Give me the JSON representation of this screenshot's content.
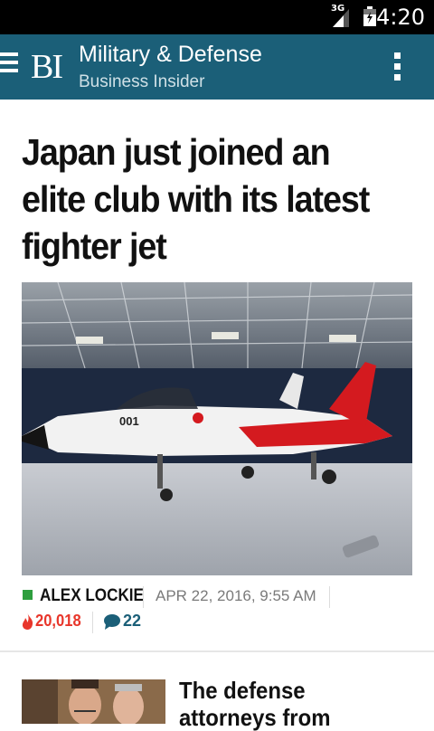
{
  "status_bar": {
    "network": "3G",
    "time": "4:20"
  },
  "app_bar": {
    "logo": "BI",
    "title": "Military & Defense",
    "subtitle": "Business Insider"
  },
  "article": {
    "headline": "Japan just joined an elite club with its latest fighter jet",
    "author": "ALEX LOCKIE",
    "date": "APR 22, 2016, 9:55 AM",
    "views": "20,018",
    "comments": "22",
    "colors": {
      "accent": "#1b5f78",
      "author_square": "#2e9e3e",
      "views": "#e8362b"
    }
  },
  "next_article": {
    "title": "The defense attorneys from"
  },
  "icons": [
    "menu-icon",
    "overflow-menu-icon",
    "signal-icon",
    "battery-icon",
    "flame-icon",
    "comment-icon"
  ]
}
